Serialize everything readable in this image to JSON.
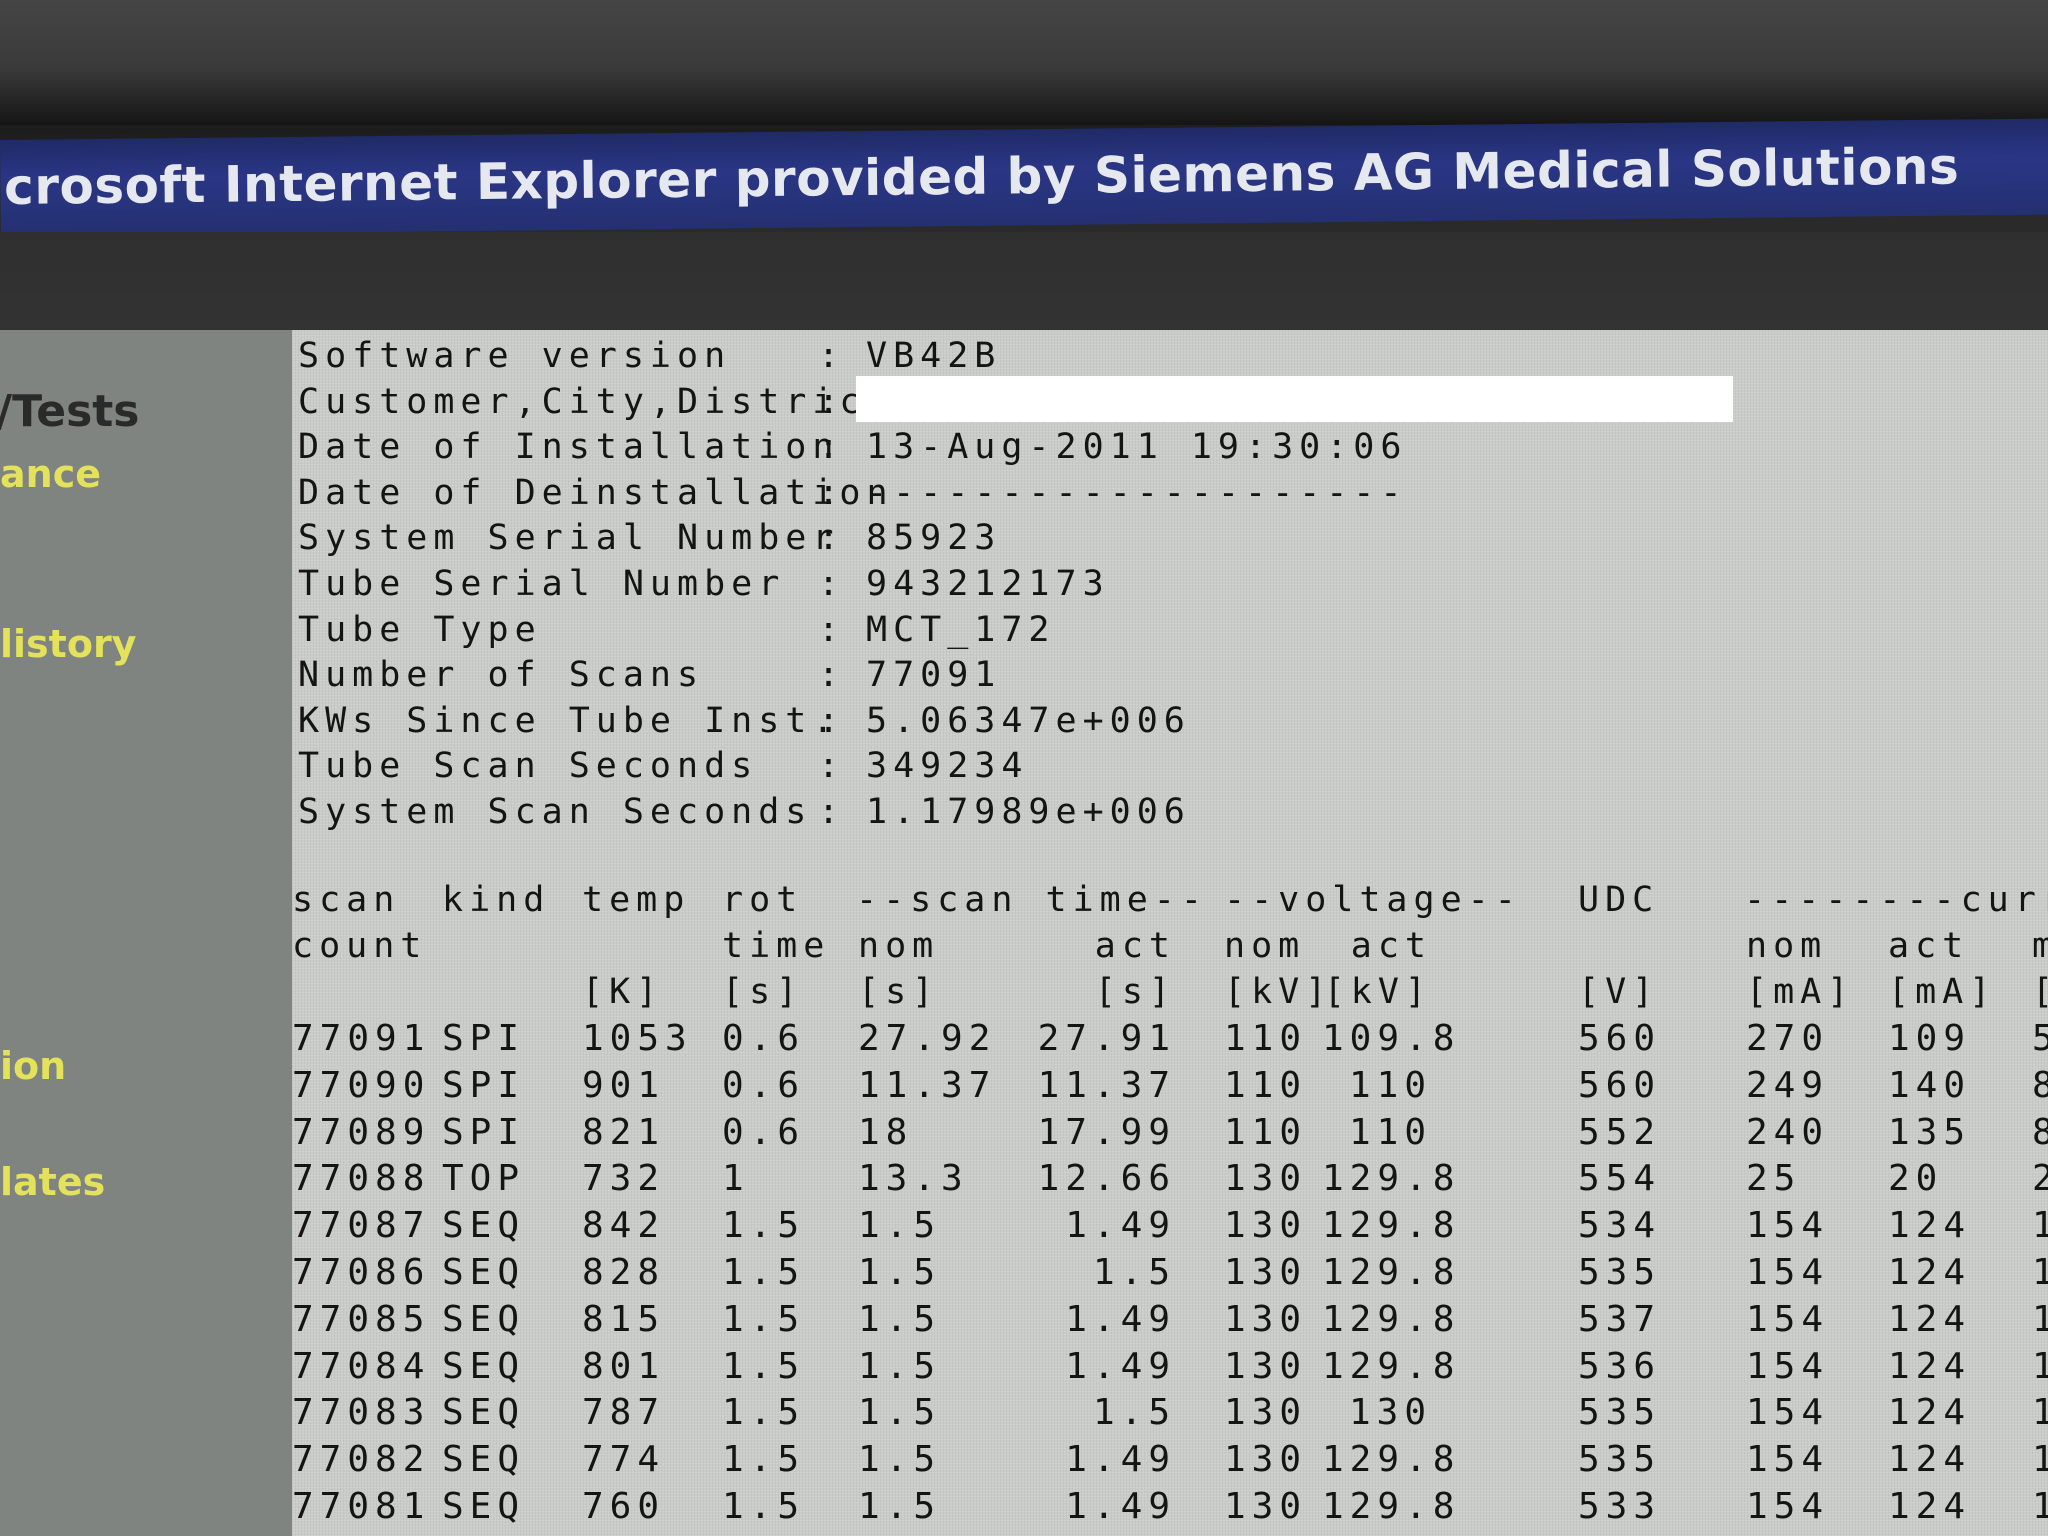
{
  "window": {
    "title": "icrosoft Internet Explorer provided by Siemens AG Medical Solutions"
  },
  "sidebar": {
    "heading": "/Tests",
    "items": [
      {
        "label": "ance"
      },
      {
        "label": "listory"
      },
      {
        "label": "ion"
      },
      {
        "label": "lates"
      }
    ]
  },
  "system_info": [
    {
      "label": "Software version",
      "value": "VB42B"
    },
    {
      "label": "Customer,City,District",
      "value": ""
    },
    {
      "label": "Date of Installation",
      "value": "13-Aug-2011 19:30:06"
    },
    {
      "label": "Date of Deinstallation",
      "value": "--------------------"
    },
    {
      "label": "System Serial Number",
      "value": "85923"
    },
    {
      "label": "Tube Serial Number",
      "value": "943212173"
    },
    {
      "label": "Tube Type",
      "value": "MCT_172"
    },
    {
      "label": "Number of Scans",
      "value": "77091"
    },
    {
      "label": "KWs Since Tube Inst.",
      "value": "5.06347e+006"
    },
    {
      "label": "Tube Scan Seconds",
      "value": "349234"
    },
    {
      "label": "System Scan Seconds",
      "value": "1.17989e+006"
    }
  ],
  "scan_table": {
    "group_headers": {
      "scan_time": "--scan time--",
      "voltage": "--voltage--",
      "current": "--------curre"
    },
    "headers": {
      "scan_count": [
        "scan",
        "count"
      ],
      "kind": "kind",
      "temp": [
        "temp",
        "[K]"
      ],
      "rot_time": [
        "rot",
        "time",
        "[s]"
      ],
      "scan_nom": [
        "nom",
        "[s]"
      ],
      "scan_act": [
        "act",
        "[s]"
      ],
      "volt_nom": [
        "nom",
        "[kV]"
      ],
      "volt_act": [
        "act",
        "[kV]"
      ],
      "udc": [
        "UDC",
        "[V]"
      ],
      "cur_nom": [
        "nom",
        "[mA]"
      ],
      "cur_act": [
        "act",
        "[mA]"
      ],
      "cur_cut": [
        "m",
        "["
      ]
    },
    "rows": [
      {
        "scan_count": "77091",
        "kind": "SPI",
        "temp": "1053",
        "rot_time": "0.6",
        "scan_nom": "27.92",
        "scan_act": "27.91",
        "volt_nom": "110",
        "volt_act": "109.8",
        "udc": "560",
        "cur_nom": "270",
        "cur_act": "109",
        "cur_cut": "5"
      },
      {
        "scan_count": "77090",
        "kind": "SPI",
        "temp": "901",
        "rot_time": "0.6",
        "scan_nom": "11.37",
        "scan_act": "11.37",
        "volt_nom": "110",
        "volt_act": "110",
        "udc": "560",
        "cur_nom": "249",
        "cur_act": "140",
        "cur_cut": "8"
      },
      {
        "scan_count": "77089",
        "kind": "SPI",
        "temp": "821",
        "rot_time": "0.6",
        "scan_nom": "18",
        "scan_act": "17.99",
        "volt_nom": "110",
        "volt_act": "110",
        "udc": "552",
        "cur_nom": "240",
        "cur_act": "135",
        "cur_cut": "8"
      },
      {
        "scan_count": "77088",
        "kind": "TOP",
        "temp": "732",
        "rot_time": "1",
        "scan_nom": "13.3",
        "scan_act": "12.66",
        "volt_nom": "130",
        "volt_act": "129.8",
        "udc": "554",
        "cur_nom": "25",
        "cur_act": "20",
        "cur_cut": "2"
      },
      {
        "scan_count": "77087",
        "kind": "SEQ",
        "temp": "842",
        "rot_time": "1.5",
        "scan_nom": "1.5",
        "scan_act": "1.49",
        "volt_nom": "130",
        "volt_act": "129.8",
        "udc": "534",
        "cur_nom": "154",
        "cur_act": "124",
        "cur_cut": "1"
      },
      {
        "scan_count": "77086",
        "kind": "SEQ",
        "temp": "828",
        "rot_time": "1.5",
        "scan_nom": "1.5",
        "scan_act": "1.5",
        "volt_nom": "130",
        "volt_act": "129.8",
        "udc": "535",
        "cur_nom": "154",
        "cur_act": "124",
        "cur_cut": "1"
      },
      {
        "scan_count": "77085",
        "kind": "SEQ",
        "temp": "815",
        "rot_time": "1.5",
        "scan_nom": "1.5",
        "scan_act": "1.49",
        "volt_nom": "130",
        "volt_act": "129.8",
        "udc": "537",
        "cur_nom": "154",
        "cur_act": "124",
        "cur_cut": "1"
      },
      {
        "scan_count": "77084",
        "kind": "SEQ",
        "temp": "801",
        "rot_time": "1.5",
        "scan_nom": "1.5",
        "scan_act": "1.49",
        "volt_nom": "130",
        "volt_act": "129.8",
        "udc": "536",
        "cur_nom": "154",
        "cur_act": "124",
        "cur_cut": "1"
      },
      {
        "scan_count": "77083",
        "kind": "SEQ",
        "temp": "787",
        "rot_time": "1.5",
        "scan_nom": "1.5",
        "scan_act": "1.5",
        "volt_nom": "130",
        "volt_act": "130",
        "udc": "535",
        "cur_nom": "154",
        "cur_act": "124",
        "cur_cut": "1"
      },
      {
        "scan_count": "77082",
        "kind": "SEQ",
        "temp": "774",
        "rot_time": "1.5",
        "scan_nom": "1.5",
        "scan_act": "1.49",
        "volt_nom": "130",
        "volt_act": "129.8",
        "udc": "535",
        "cur_nom": "154",
        "cur_act": "124",
        "cur_cut": "1"
      },
      {
        "scan_count": "77081",
        "kind": "SEQ",
        "temp": "760",
        "rot_time": "1.5",
        "scan_nom": "1.5",
        "scan_act": "1.49",
        "volt_nom": "130",
        "volt_act": "129.8",
        "udc": "533",
        "cur_nom": "154",
        "cur_act": "124",
        "cur_cut": "1"
      }
    ]
  }
}
